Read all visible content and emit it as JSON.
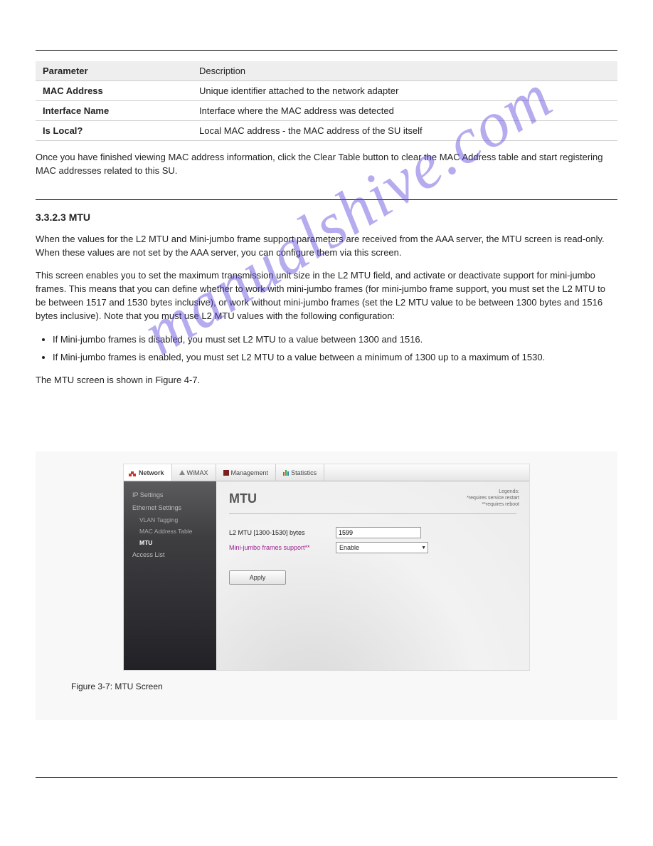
{
  "watermark": "manualshive.com",
  "table": {
    "header": {
      "c1": "Parameter",
      "c2": "Description"
    },
    "rows": [
      {
        "c1": "MAC Address",
        "c2": "Unique identifier attached to the network adapter"
      },
      {
        "c1": "Interface Name",
        "c2": "Interface where the MAC address was detected"
      },
      {
        "c1": "Is Local?",
        "c2": "Local MAC address - the MAC address of the SU itself"
      }
    ]
  },
  "body_paragraph": "Once you have finished viewing MAC address information, click the Clear Table button to clear the MAC Address table and start registering MAC addresses related to this SU.",
  "section_heading": "3.3.2.3 MTU",
  "p1": "When the values for the L2 MTU and Mini-jumbo frame support parameters are received from the AAA server, the MTU screen is read-only. When these values are not set by the AAA server, you can configure them via this screen.",
  "p2": "This screen enables you to set the maximum transmission unit size in the L2 MTU field, and activate or deactivate support for mini-jumbo frames. This means that you can define whether to work with mini-jumbo frames (for mini-jumbo frame support, you must set the L2 MTU to be between 1517 and 1530 bytes inclusive), or work without mini-jumbo frames (set the L2 MTU value to be between 1300 bytes and 1516 bytes inclusive). Note that you must use L2 MTU values with the following configuration:",
  "bullets": [
    "If Mini-jumbo frames is disabled, you must set L2 MTU to a value between 1300 and 1516.",
    "If Mini-jumbo frames is enabled, you must set L2 MTU to a value between a minimum of 1300 up to a maximum of 1530."
  ],
  "p3": "The MTU screen is shown in Figure 4-7.",
  "figure": {
    "tabs": [
      "Network",
      "WiMAX",
      "Management",
      "Statistics"
    ],
    "sidebar": {
      "items": [
        {
          "lvl": 0,
          "label": "IP Settings",
          "active": false
        },
        {
          "lvl": 0,
          "label": "Ethernet Settings",
          "active": false
        },
        {
          "lvl": 1,
          "label": "VLAN Tagging",
          "active": false
        },
        {
          "lvl": 1,
          "label": "MAC Address Table",
          "active": false
        },
        {
          "lvl": 1,
          "label": "MTU",
          "active": true
        },
        {
          "lvl": 0,
          "label": "Access List",
          "active": false
        }
      ]
    },
    "page_title": "MTU",
    "legends": {
      "title": "Legends:",
      "l1": "*requires service restart",
      "l2": "**requires reboot"
    },
    "form": {
      "row1_label": "L2 MTU [1300-1530] bytes",
      "row1_value": "1599",
      "row2_label": "Mini-jumbo frames support**",
      "row2_value": "Enable"
    },
    "apply_label": "Apply"
  },
  "figure_caption": "Figure 3-7: MTU Screen",
  "footer": {
    "left": "",
    "right": ""
  }
}
